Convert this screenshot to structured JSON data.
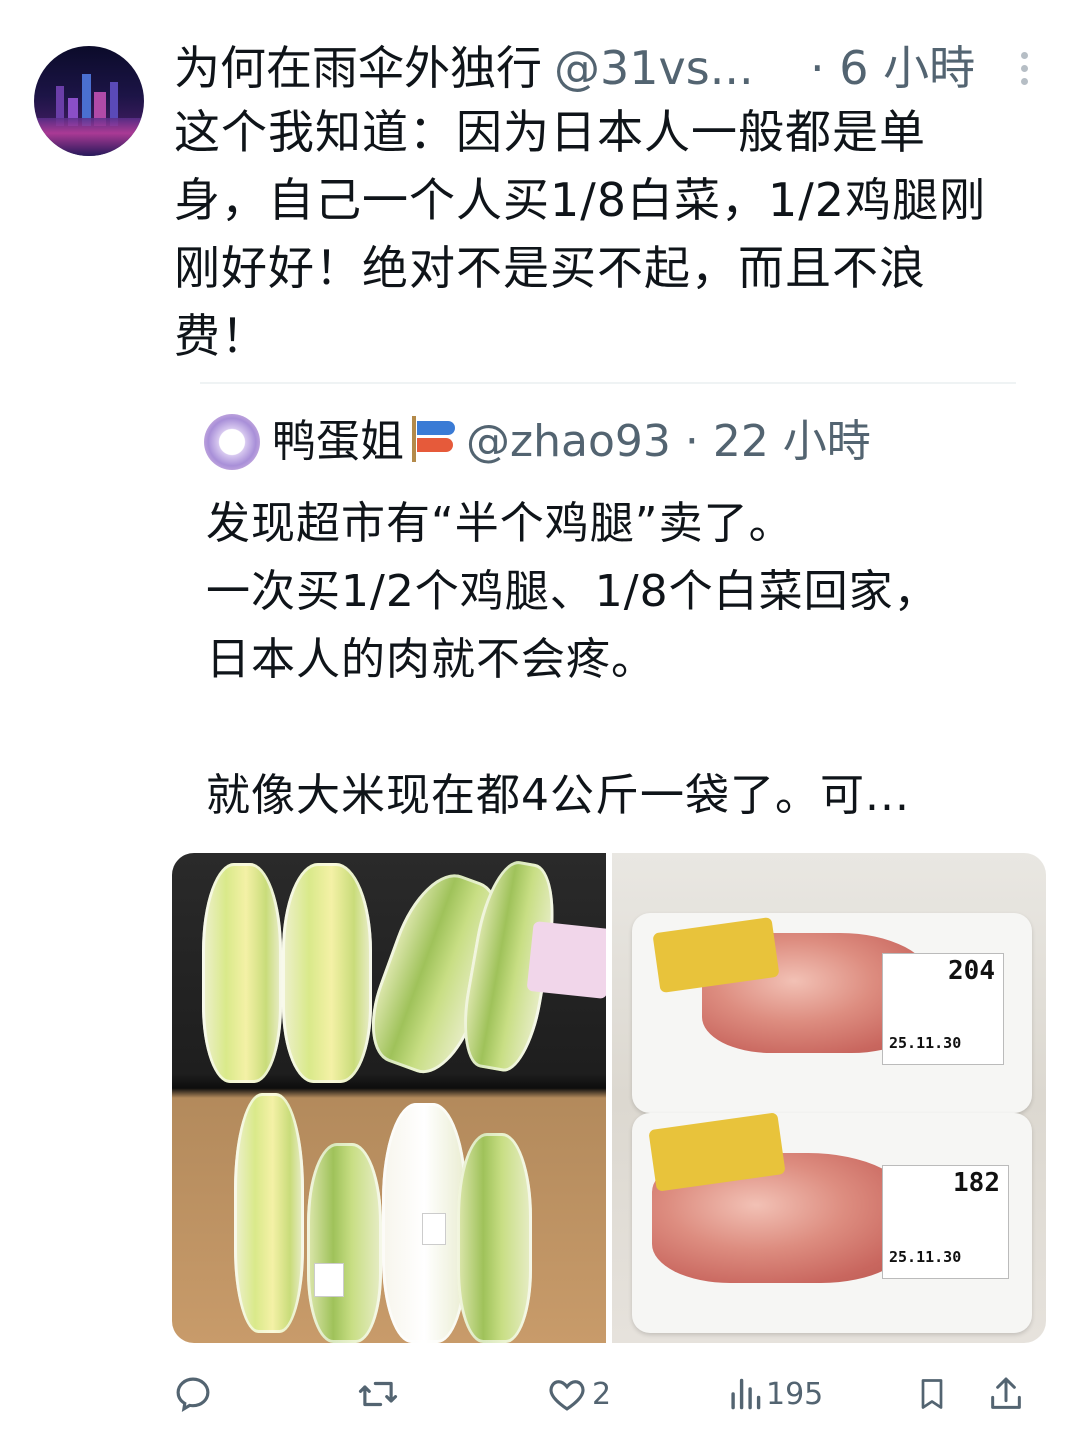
{
  "post": {
    "author_name": "为何在雨伞外独行",
    "author_handle": "@31vs...",
    "time": "· 6 小時",
    "text_lines": [
      "这个我知道：因为日本人一般都是单",
      "身，自己一个人买1/8白菜，1/2鸡腿刚",
      "刚好好！绝对不是买不起，而且不浪",
      "费！"
    ]
  },
  "quote": {
    "author_name": "鸭蛋姐",
    "author_handle": "@zhao93",
    "time": "· 22 小時",
    "text_lines": [
      "发现超市有“半个鸡腿”卖了。",
      "一次买1/2个鸡腿、1/8个白菜回家，",
      "日本人的肉就不会疼。",
      "",
      "就像大米现在都4公斤一袋了。可..."
    ]
  },
  "photos": {
    "right": {
      "top_tag": {
        "num": "204",
        "date": "25.11.30"
      },
      "bottom_tag": {
        "num": "182",
        "date": "25.11.30"
      }
    }
  },
  "actions": {
    "reply_count": "",
    "repost_count": "",
    "like_count": "2",
    "views_count": "195"
  },
  "colors": {
    "text": "#0f1419",
    "secondary": "#536471",
    "divider": "#eff3f4"
  },
  "icons": [
    "more-icon",
    "reply-icon",
    "repost-icon",
    "like-icon",
    "views-icon",
    "bookmark-icon",
    "share-icon",
    "koinobori-icon"
  ]
}
